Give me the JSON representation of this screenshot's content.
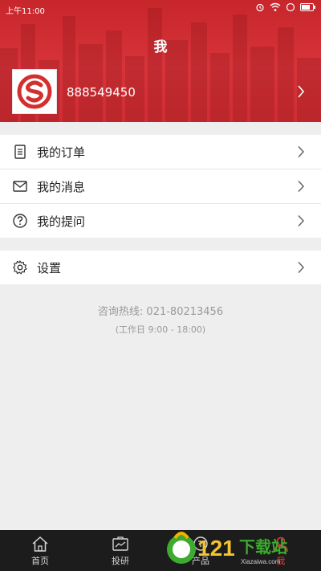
{
  "statusbar": {
    "time": "上午11:00"
  },
  "header": {
    "title": "我",
    "account_number": "888549450"
  },
  "menu": {
    "group1": [
      {
        "label": "我的订单",
        "icon": "document-icon"
      },
      {
        "label": "我的消息",
        "icon": "mail-icon"
      },
      {
        "label": "我的提问",
        "icon": "question-icon"
      }
    ],
    "group2": [
      {
        "label": "设置",
        "icon": "gear-icon"
      }
    ]
  },
  "contact": {
    "hotline": "咨询热线: 021-80213456",
    "hours": "(工作日 9:00 - 18:00)"
  },
  "tabs": [
    {
      "label": "首页",
      "icon": "home-icon",
      "active": false
    },
    {
      "label": "投研",
      "icon": "research-icon",
      "active": false
    },
    {
      "label": "产品",
      "icon": "product-icon",
      "active": false
    },
    {
      "label": "我",
      "icon": "user-icon",
      "active": true
    }
  ],
  "watermark": {
    "text": "121下载站",
    "sub": "Xiazaiwa.com"
  },
  "colors": {
    "brand_red": "#d6343a",
    "tab_active": "#e33b3b",
    "tabbar_bg": "#1c1c1c"
  }
}
